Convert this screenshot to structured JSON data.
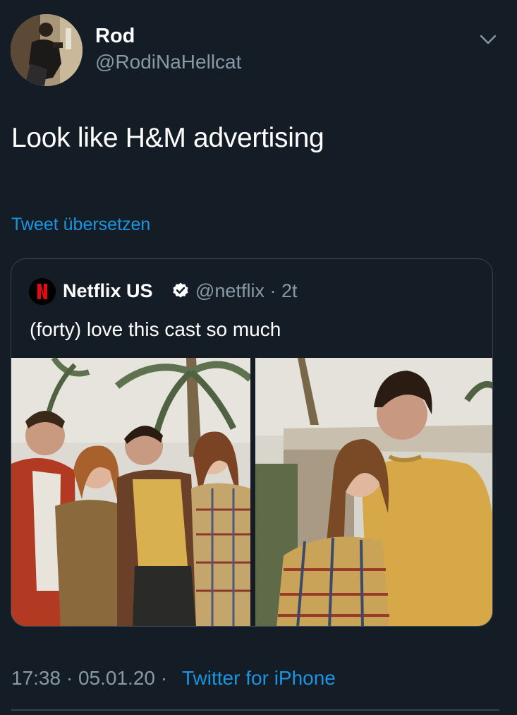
{
  "tweet": {
    "user": {
      "name": "Rod",
      "handle": "@RodiNaHellcat"
    },
    "text": "Look like H&M advertising",
    "translate_label": "Tweet übersetzen",
    "quoted": {
      "name": "Netflix US",
      "handle": "@netflix",
      "separator": "·",
      "age": "2t",
      "text": "(forty) love this cast so much"
    },
    "time": "17:38",
    "date": "05.01.20",
    "separator": "·",
    "source": "Twitter for iPhone"
  },
  "icons": {
    "menu": "chevron-down-icon",
    "verified": "verified-badge-icon",
    "netflix": "netflix-logo-icon"
  },
  "colors": {
    "background": "#141d26",
    "text_primary": "#ffffff",
    "text_secondary": "#8899a6",
    "link": "#1b95e0",
    "border": "#38444d",
    "netflix_red": "#e50914"
  }
}
